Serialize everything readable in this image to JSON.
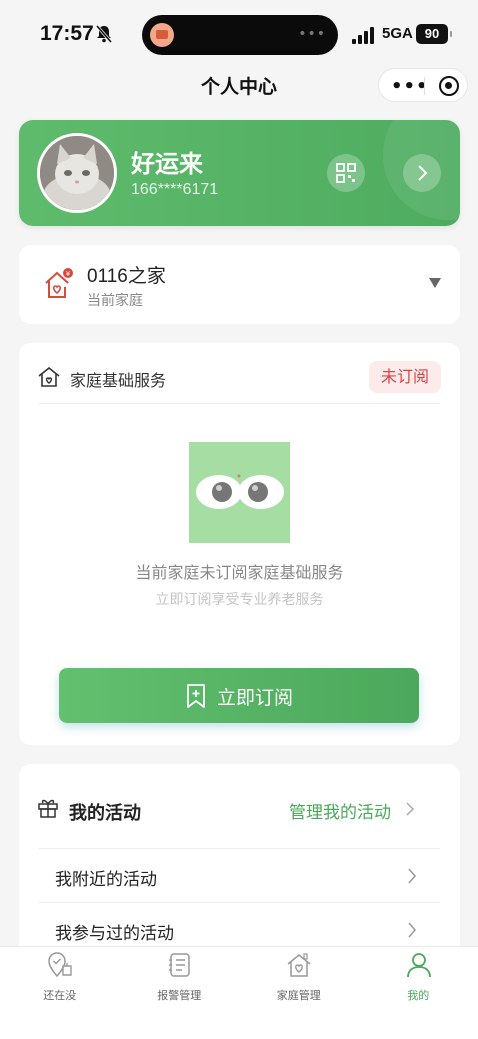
{
  "status_bar": {
    "time": "17:57",
    "network": "5GA",
    "battery": "90"
  },
  "navbar": {
    "title": "个人中心"
  },
  "profile": {
    "name": "好运来",
    "phone": "166****6171"
  },
  "family": {
    "name": "0116之家",
    "subtitle": "当前家庭"
  },
  "service": {
    "title": "家庭基础服务",
    "badge": "未订阅",
    "empty_main": "当前家庭未订阅家庭基础服务",
    "empty_sub": "立即订阅享受专业养老服务",
    "subscribe_label": "立即订阅"
  },
  "activity": {
    "title": "我的活动",
    "manage_label": "管理我的活动",
    "rows": [
      {
        "label": "我附近的活动"
      },
      {
        "label": "我参与过的活动"
      }
    ]
  },
  "tabbar": {
    "items": [
      {
        "label": "还在没",
        "icon": "location-shield-icon",
        "active": false
      },
      {
        "label": "报警管理",
        "icon": "list-icon",
        "active": false
      },
      {
        "label": "家庭管理",
        "icon": "home-heart-icon",
        "active": false
      },
      {
        "label": "我的",
        "icon": "user-icon",
        "active": true
      }
    ]
  },
  "colors": {
    "brand_green": "#4eac60",
    "badge_red": "#d54646",
    "page_bg": "#f4f5f4"
  }
}
